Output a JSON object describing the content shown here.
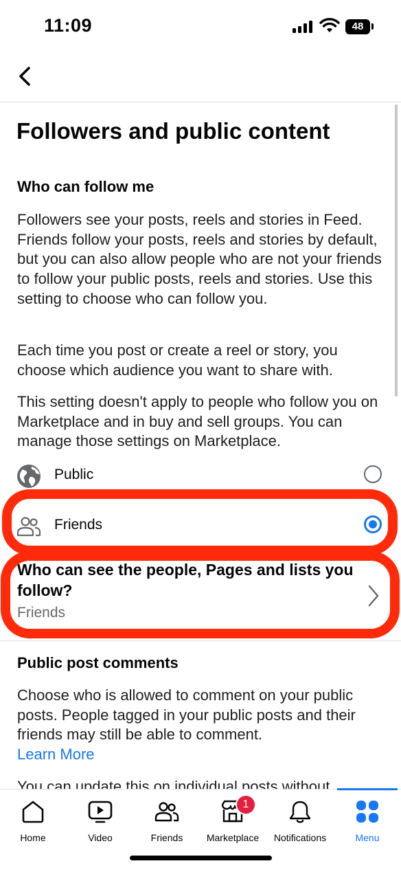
{
  "status_bar": {
    "time": "11:09",
    "battery": "48"
  },
  "page": {
    "title": "Followers and public content",
    "who_can_follow": {
      "heading": "Who can follow me",
      "paragraph1": "Followers see your posts, reels and stories in Feed. Friends follow your posts, reels and stories by default, but you can also allow people who are not your friends to follow your public posts, reels and stories. Use this setting to choose who can follow you.",
      "paragraph2": "Each time you post or create a reel or story, you choose which audience you want to share with.",
      "paragraph3": "This setting doesn't apply to people who follow you on Marketplace and in buy and sell groups. You can manage those settings on Marketplace.",
      "options": [
        {
          "label": "Public",
          "icon": "globe-icon",
          "selected": false
        },
        {
          "label": "Friends",
          "icon": "friends-icon",
          "selected": true
        }
      ]
    },
    "follow_list": {
      "title": "Who can see the people, Pages and lists you follow?",
      "value": "Friends"
    },
    "public_comments": {
      "heading": "Public post comments",
      "paragraph": "Choose who is allowed to comment on your public posts. People tagged in your public posts and their friends may still be able to comment.",
      "link": "Learn More",
      "partial_text": "You can update this on individual posts without"
    }
  },
  "tabs": [
    {
      "label": "Home",
      "icon": "home-icon"
    },
    {
      "label": "Video",
      "icon": "video-icon"
    },
    {
      "label": "Friends",
      "icon": "friends-icon"
    },
    {
      "label": "Marketplace",
      "icon": "marketplace-icon",
      "badge": "1"
    },
    {
      "label": "Notifications",
      "icon": "bell-icon"
    },
    {
      "label": "Menu",
      "icon": "menu-grid-icon",
      "active": true
    }
  ],
  "colors": {
    "accent": "#1877f2",
    "highlight": "#ff2a0a",
    "badge": "#e41e3f"
  }
}
